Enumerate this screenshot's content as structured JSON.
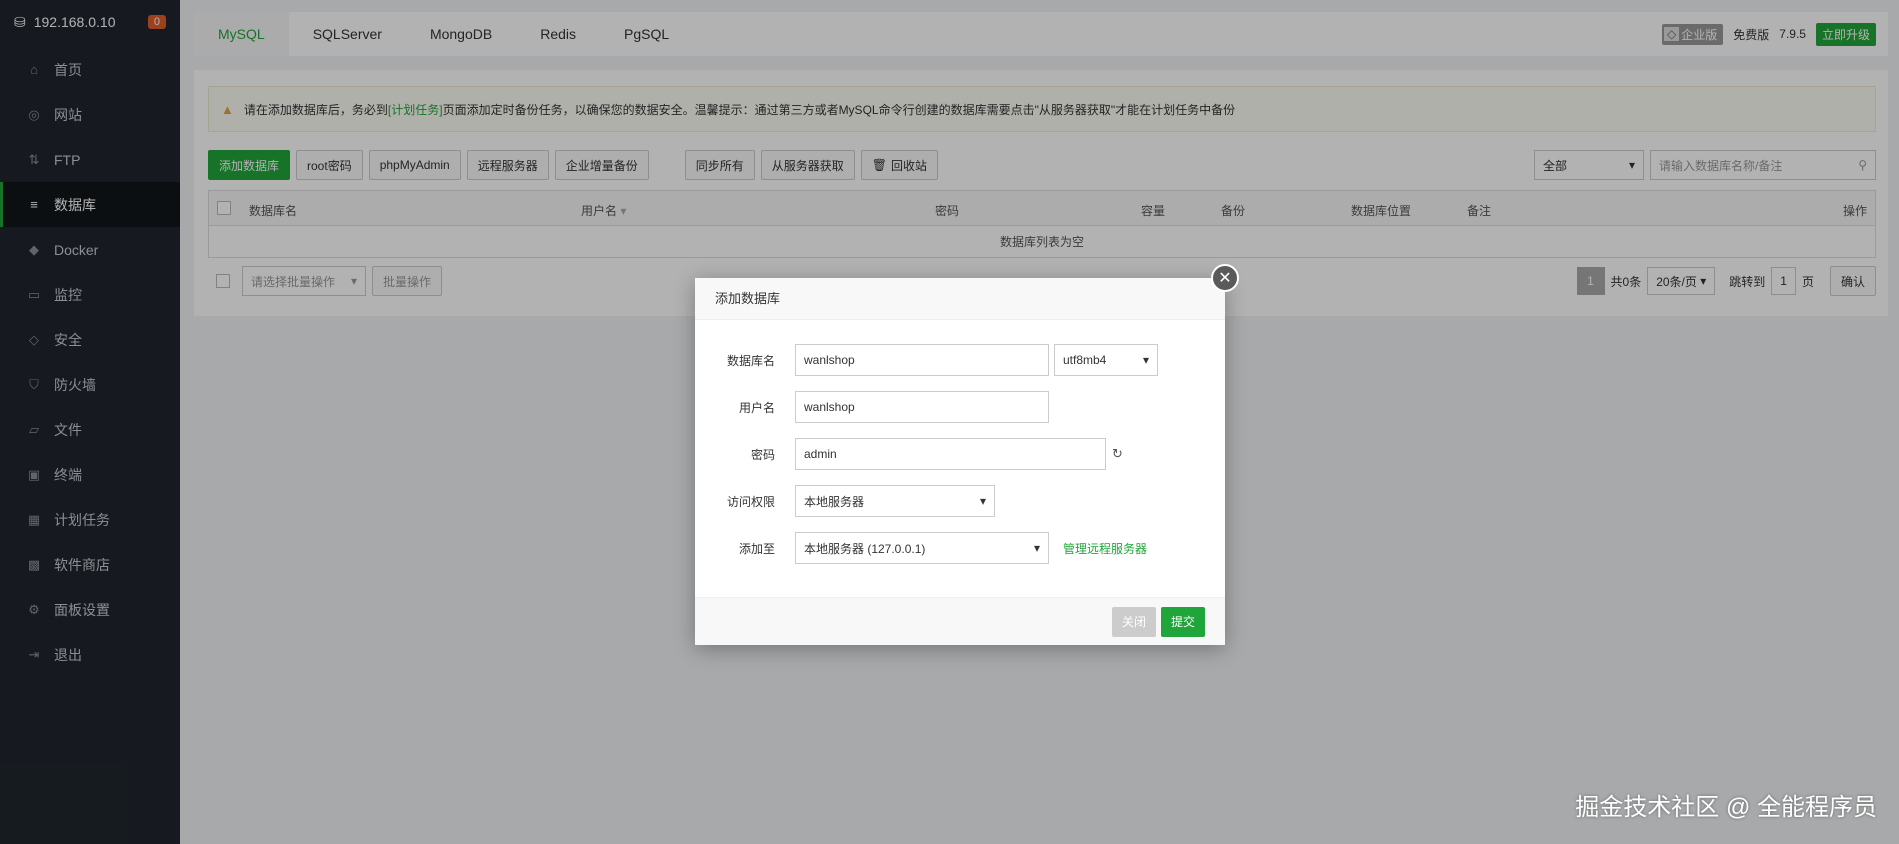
{
  "sidebar": {
    "ip": "192.168.0.10",
    "badge": "0",
    "items": [
      {
        "label": "首页",
        "icon": "home-icon",
        "glyph": "⌂"
      },
      {
        "label": "网站",
        "icon": "globe-icon",
        "glyph": "◎"
      },
      {
        "label": "FTP",
        "icon": "ftp-icon",
        "glyph": "⇅"
      },
      {
        "label": "数据库",
        "icon": "database-icon",
        "glyph": "≡"
      },
      {
        "label": "Docker",
        "icon": "docker-icon",
        "glyph": "◆"
      },
      {
        "label": "监控",
        "icon": "monitor-icon",
        "glyph": "▭"
      },
      {
        "label": "安全",
        "icon": "shield-icon",
        "glyph": "◇"
      },
      {
        "label": "防火墙",
        "icon": "firewall-icon",
        "glyph": "⛉"
      },
      {
        "label": "文件",
        "icon": "folder-icon",
        "glyph": "▱"
      },
      {
        "label": "终端",
        "icon": "terminal-icon",
        "glyph": "▣"
      },
      {
        "label": "计划任务",
        "icon": "calendar-icon",
        "glyph": "▦"
      },
      {
        "label": "软件商店",
        "icon": "store-icon",
        "glyph": "▩"
      },
      {
        "label": "面板设置",
        "icon": "gear-icon",
        "glyph": "⚙"
      },
      {
        "label": "退出",
        "icon": "logout-icon",
        "glyph": "⇥"
      }
    ]
  },
  "tabs": [
    "MySQL",
    "SQLServer",
    "MongoDB",
    "Redis",
    "PgSQL"
  ],
  "topright": {
    "edition": "企业版",
    "free": "免费版",
    "version": "7.9.5",
    "upgrade": "立即升级"
  },
  "notice": {
    "pre": "请在添加数据库后，务必到",
    "link": "[计划任务]",
    "post": "页面添加定时备份任务，以确保您的数据安全。温馨提示：通过第三方或者MySQL命令行创建的数据库需要点击\"从服务器获取\"才能在计划任务中备份"
  },
  "toolbar": {
    "add": "添加数据库",
    "root": "root密码",
    "pma": "phpMyAdmin",
    "remote": "远程服务器",
    "backup": "企业增量备份",
    "sync": "同步所有",
    "fetch": "从服务器获取",
    "recycle": "回收站",
    "filter": "全部",
    "search_placeholder": "请输入数据库名称/备注"
  },
  "table": {
    "headers": {
      "name": "数据库名",
      "user": "用户名",
      "password": "密码",
      "capacity": "容量",
      "backup": "备份",
      "location": "数据库位置",
      "remark": "备注",
      "ops": "操作"
    },
    "empty": "数据库列表为空"
  },
  "footer": {
    "batch_select": "请选择批量操作",
    "batch_btn": "批量操作",
    "page": "1",
    "total": "共0条",
    "per_page": "20条/页",
    "jump": "跳转到",
    "jump_page": "1",
    "page_unit": "页",
    "confirm": "确认"
  },
  "dialog": {
    "title": "添加数据库",
    "name_label": "数据库名",
    "name_value": "wanlshop",
    "charset": "utf8mb4",
    "user_label": "用户名",
    "user_value": "wanlshop",
    "pass_label": "密码",
    "pass_value": "admin",
    "access_label": "访问权限",
    "access_value": "本地服务器",
    "addto_label": "添加至",
    "addto_value": "本地服务器 (127.0.0.1)",
    "manage_link": "管理远程服务器",
    "close_btn": "关闭",
    "submit_btn": "提交"
  },
  "watermark": "掘金技术社区 @ 全能程序员",
  "colors": {
    "accent": "#20a53a",
    "sidebar_bg": "#20262e",
    "badge": "#e15c2a"
  }
}
